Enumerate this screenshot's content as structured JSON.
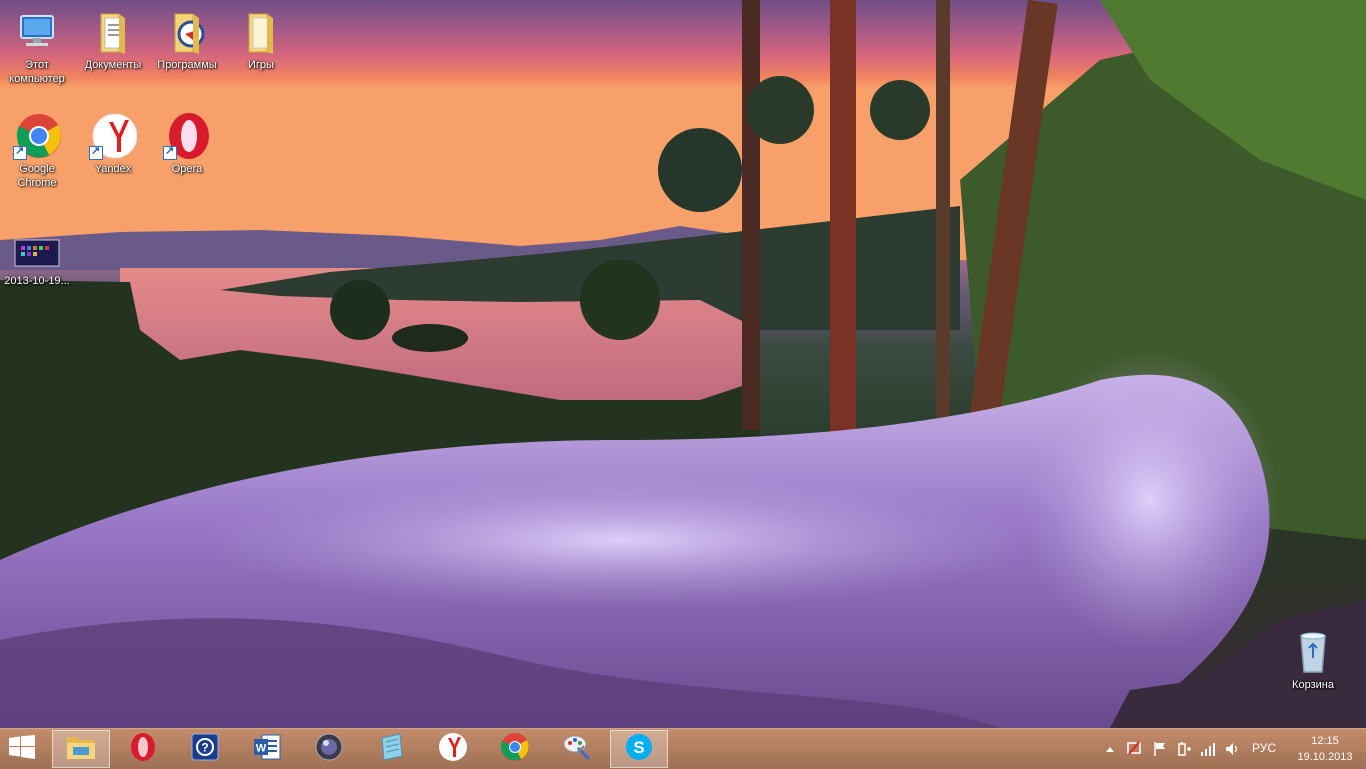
{
  "desktop": {
    "icons": [
      {
        "label": "Этот\nкомпьютер",
        "icon": "computer-icon"
      },
      {
        "label": "Документы",
        "icon": "documents-folder-icon"
      },
      {
        "label": "Программы",
        "icon": "programs-folder-icon"
      },
      {
        "label": "Игры",
        "icon": "games-folder-icon"
      },
      {
        "label": "Google\nChrome",
        "icon": "chrome-icon"
      },
      {
        "label": "Yandex",
        "icon": "yandex-browser-icon"
      },
      {
        "label": "Opera",
        "icon": "opera-icon"
      },
      {
        "label": "2013-10-19...",
        "icon": "screenshot-file-icon"
      },
      {
        "label": "Корзина",
        "icon": "recycle-bin-icon"
      }
    ]
  },
  "taskbar": {
    "start_icon": "windows-logo-icon",
    "pinned": [
      {
        "name": "file-explorer",
        "icon": "file-explorer-icon",
        "active": true
      },
      {
        "name": "opera",
        "icon": "opera-icon",
        "active": false
      },
      {
        "name": "help",
        "icon": "help-icon",
        "active": false
      },
      {
        "name": "word",
        "icon": "word-icon",
        "active": false
      },
      {
        "name": "media",
        "icon": "media-orb-icon",
        "active": false
      },
      {
        "name": "notes",
        "icon": "notes-icon",
        "active": false
      },
      {
        "name": "yandex",
        "icon": "yandex-browser-icon",
        "active": false
      },
      {
        "name": "chrome",
        "icon": "chrome-icon",
        "active": false
      },
      {
        "name": "paint-tool",
        "icon": "paint-tool-icon",
        "active": false
      },
      {
        "name": "skype",
        "icon": "skype-icon",
        "active": true
      }
    ],
    "tray": {
      "language": "РУС",
      "time": "12:15",
      "date": "19.10.2013",
      "icons": [
        "show-hidden-icon",
        "network-warning-icon",
        "action-center-flag-icon",
        "power-icon",
        "signal-bars-icon",
        "volume-icon"
      ]
    }
  },
  "colors": {
    "taskbar_tint": "#a8785a",
    "sky_pink": "#f07a60",
    "water_purple": "#8a6ab0"
  }
}
